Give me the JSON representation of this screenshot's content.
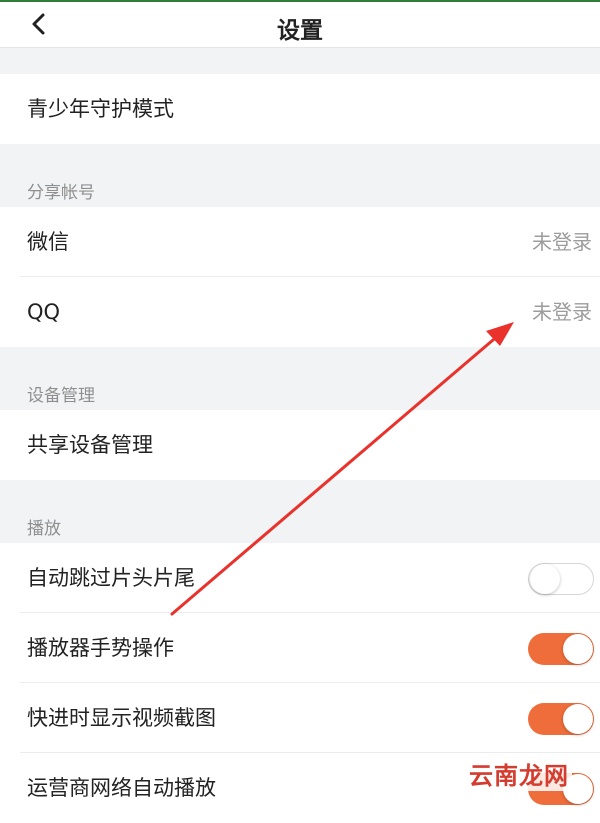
{
  "header": {
    "title": "设置",
    "back_icon": "chevron-left-icon"
  },
  "teen_mode": {
    "label": "青少年守护模式"
  },
  "share_accounts": {
    "title": "分享帐号",
    "items": [
      {
        "label": "微信",
        "status": "未登录"
      },
      {
        "label": "QQ",
        "status": "未登录"
      }
    ]
  },
  "device": {
    "title": "设备管理",
    "items": [
      {
        "label": "共享设备管理"
      }
    ]
  },
  "playback": {
    "title": "播放",
    "items": [
      {
        "label": "自动跳过片头片尾",
        "enabled": false
      },
      {
        "label": "播放器手势操作",
        "enabled": true
      },
      {
        "label": "快进时显示视频截图",
        "enabled": true
      },
      {
        "label": "运营商网络自动播放",
        "enabled": true
      }
    ]
  },
  "watermark": "云南龙网",
  "colors": {
    "accent": "#ee6d3a",
    "arrow": "#e8322b",
    "background": "#f2f3f5"
  }
}
